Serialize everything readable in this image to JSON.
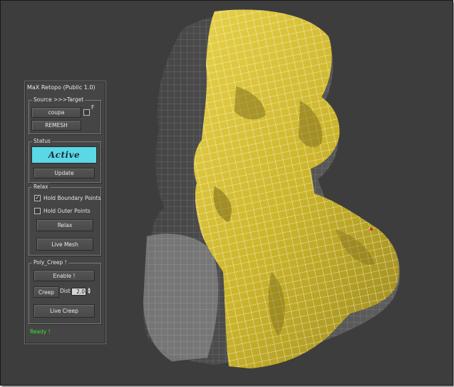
{
  "panel": {
    "title": "MaX Retopo   (Public 1.0)"
  },
  "source_target": {
    "label": "Source >>>Target",
    "target_button": "coupa",
    "f_checkbox_label": "F",
    "remesh_button": "REMESH"
  },
  "status": {
    "label": "Status",
    "value": "Active",
    "update_button": "Update"
  },
  "relax": {
    "label": "Relax",
    "hold_boundary_label": "Hold Boundary Points",
    "hold_boundary_checked": true,
    "hold_outer_label": "Hold Outer Points",
    "hold_outer_checked": false,
    "relax_button": "Relax",
    "live_mesh_button": "Live Mesh"
  },
  "poly_creep": {
    "label": "Poly_Creep !",
    "enable_button": "Enable !",
    "creep_button": "Creep",
    "dist_label": "Dist",
    "dist_value": "2.0",
    "live_creep_button": "Live Creep"
  },
  "footer": {
    "status_text": "Ready !"
  },
  "colors": {
    "viewport_bg": "#3d3d3d",
    "status_active": "#5bd8e6",
    "ready_text": "#39e039",
    "mesh_yellow": "#d8c233"
  }
}
